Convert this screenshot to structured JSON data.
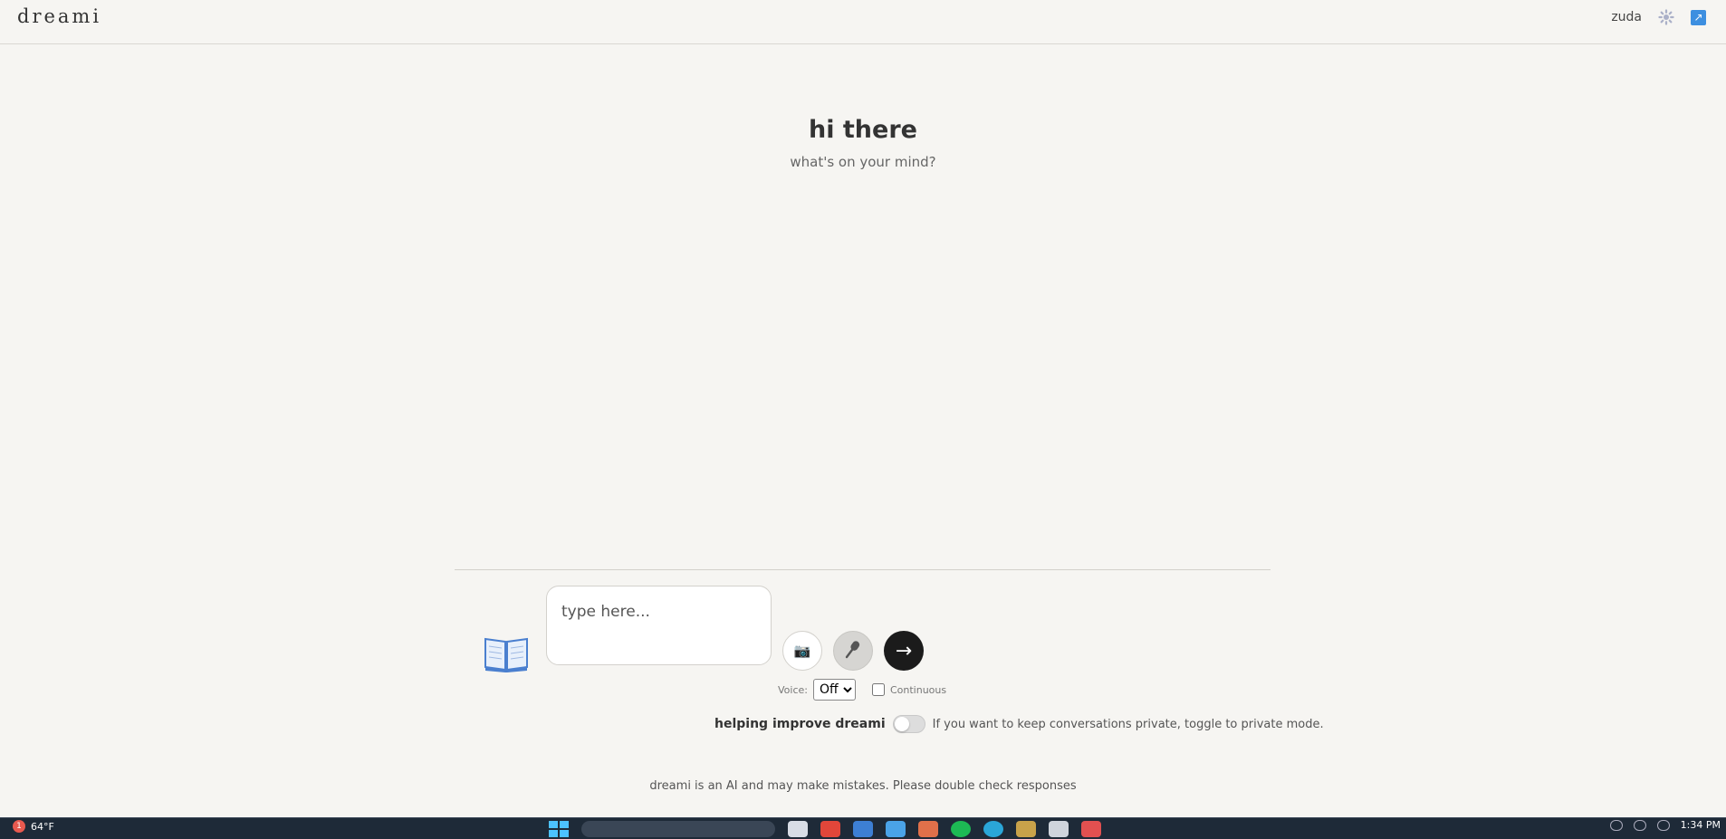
{
  "header": {
    "logo": "dreami",
    "username": "zuda",
    "settings_icon": "gear-icon",
    "open_icon": "external-link-icon",
    "open_glyph": "↗"
  },
  "greeting": {
    "title": "hi there",
    "subtitle": "what's on your mind?"
  },
  "composer": {
    "journal_icon": "open-book-icon",
    "input_placeholder": "type here...",
    "input_value": "",
    "camera_icon": "camera-icon",
    "camera_glyph": "📷",
    "mic_icon": "microphone-icon",
    "send_icon": "arrow-right-icon",
    "send_glyph": "→",
    "voice_label": "Voice:",
    "voice_selected": "Off",
    "continuous_label": "Continuous",
    "continuous_checked": false
  },
  "privacy": {
    "label": "helping improve dreami",
    "toggle_on": false,
    "description": "If you want to keep conversations private, toggle to private mode."
  },
  "footer": {
    "disclaimer": "dreami is an AI and may make mistakes. Please double check responses"
  },
  "taskbar": {
    "weather_temp": "64°F",
    "weather_badge": "1",
    "time": "1:34 PM"
  },
  "colors": {
    "background": "#f6f5f2",
    "send_button": "#1b1b1b",
    "taskbar": "#1e2a38"
  }
}
